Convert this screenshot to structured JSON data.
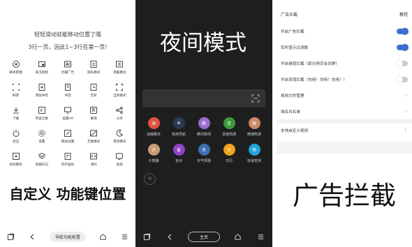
{
  "panel1": {
    "hint_line1": "轻轻滑动就能移动位置了哦",
    "hint_line2": "3行一页，因此1~3行在第一页!",
    "functions": [
      {
        "label": "脚本管理",
        "icon": "script-icon"
      },
      {
        "label": "悬浮视频",
        "icon": "floating-video-icon"
      },
      {
        "label": "拦截广告",
        "icon": "ad-block-icon"
      },
      {
        "label": "隐私模式",
        "icon": "privacy-icon"
      },
      {
        "label": "电脑模式",
        "icon": "desktop-mode-icon"
      },
      {
        "label": "刷新",
        "icon": "refresh-icon"
      },
      {
        "label": "添加书签",
        "icon": "add-bookmark-icon"
      },
      {
        "label": "书签",
        "icon": "bookmark-icon"
      },
      {
        "label": "历史",
        "icon": "history-icon"
      },
      {
        "label": "全屏模式",
        "icon": "fullscreen-icon"
      },
      {
        "label": "下载",
        "icon": "download-icon"
      },
      {
        "label": "审查元素",
        "icon": "inspect-icon"
      },
      {
        "label": "设置UA",
        "icon": "user-agent-icon"
      },
      {
        "label": "翻译",
        "icon": "translate-icon"
      },
      {
        "label": "分享",
        "icon": "share-icon"
      },
      {
        "label": "退出",
        "icon": "power-icon"
      },
      {
        "label": "设置",
        "icon": "settings-icon"
      },
      {
        "label": "网站设置",
        "icon": "site-settings-icon"
      },
      {
        "label": "无图模式",
        "icon": "no-image-icon"
      },
      {
        "label": "夜间模式",
        "icon": "moon-icon"
      },
      {
        "label": "阅读模式",
        "icon": "reader-icon"
      },
      {
        "label": "加载日记",
        "icon": "layers-icon"
      },
      {
        "label": "页内查找",
        "icon": "find-in-page-icon"
      },
      {
        "label": "源码",
        "icon": "source-code-icon"
      },
      {
        "label": "投屏",
        "icon": "cast-icon"
      }
    ],
    "big_title": "自定义 功能键位置",
    "nav_center": "导航功能配置"
  },
  "panel2": {
    "big_title": "夜间模式",
    "sites": [
      {
        "label": "油猴脚本",
        "glyph": "油",
        "color": "#e0533f"
      },
      {
        "label": "常用导航",
        "glyph": "⊕",
        "color": "#2a3a52"
      },
      {
        "label": "腾讯新闻",
        "glyph": "腾",
        "color": "#9b6bd0"
      },
      {
        "label": "百度热搜",
        "glyph": "百",
        "color": "#3d9a3d"
      },
      {
        "label": "微博热搜",
        "glyph": "微",
        "color": "#c98a66"
      },
      {
        "label": "计算器",
        "glyph": "计",
        "color": "#c79b72"
      },
      {
        "label": "省点",
        "glyph": "省",
        "color": "#8e44c6"
      },
      {
        "label": "天气预报",
        "glyph": "天",
        "color": "#3e6fb3"
      },
      {
        "label": "日历",
        "glyph": "日",
        "color": "#f0a21f"
      },
      {
        "label": "快递查询",
        "glyph": "快",
        "color": "#1fa6d6"
      }
    ],
    "add_glyph": "+",
    "nav_center": "主页"
  },
  "panel3": {
    "header_title": "广告拦截",
    "header_tutorial": "教程",
    "settings": [
      {
        "label": "开启广告拦截",
        "control": "toggle",
        "on": true
      },
      {
        "label": "实时显示过滤数",
        "control": "toggle",
        "on": true
      },
      {
        "label": "开启悬窗拦截（部分网页会白屏）",
        "control": "toggle",
        "on": false
      },
      {
        "label": "开启流氓拦截（勿用！勿用！勿用！）",
        "control": "toggle",
        "on": false
      },
      {
        "label": "规则文件管理",
        "control": "chevron"
      },
      {
        "label": "域名白名单",
        "control": "chevron"
      }
    ],
    "local_rules_label": "本地自定义规则",
    "local_rules_more": "⋮",
    "big_title": "广告拦截"
  },
  "colors": {
    "toggle_on": "#3b6fd6",
    "night_bg": "#1e1e1e"
  }
}
